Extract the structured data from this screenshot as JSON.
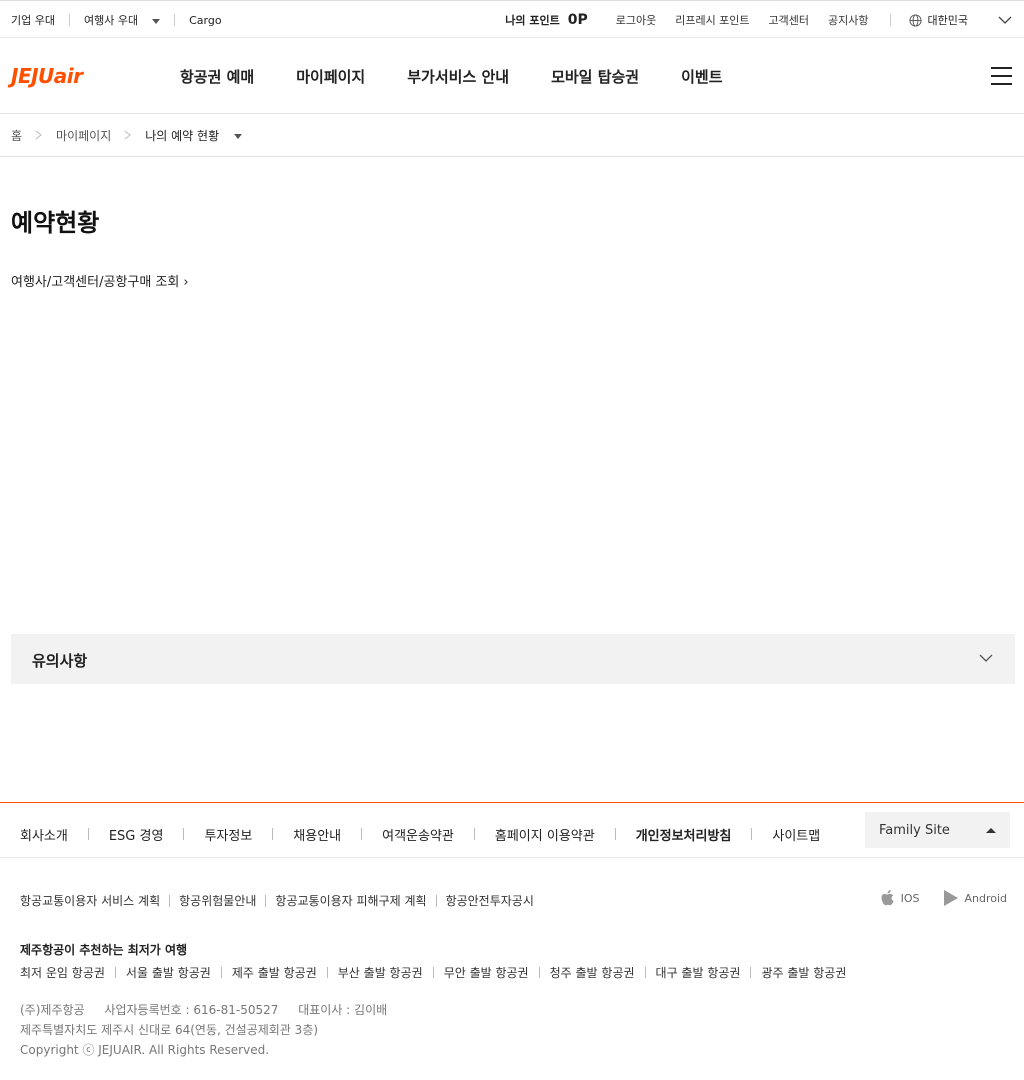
{
  "topbar": {
    "corporate": "기업 우대",
    "agency": "여행사 우대",
    "cargo": "Cargo",
    "my_points_label": "나의 포인트",
    "my_points_value": "0P",
    "logout": "로그아웃",
    "refresh_points": "리프레시 포인트",
    "customer_center": "고객센터",
    "notice": "공지사항",
    "country": "대한민국"
  },
  "logo": {
    "text": "JEJUair"
  },
  "nav": {
    "items": [
      "항공권 예매",
      "마이페이지",
      "부가서비스 안내",
      "모바일 탑승권",
      "이벤트"
    ]
  },
  "breadcrumb": {
    "home": "홈",
    "mypage": "마이페이지",
    "current": "나의 예약 현황"
  },
  "main": {
    "title": "예약현황",
    "lookup_link": "여행사/고객센터/공항구매 조회",
    "lookup_arrow": "›",
    "notice_label": "유의사항"
  },
  "footer": {
    "nav": [
      "회사소개",
      "ESG 경영",
      "투자정보",
      "채용안내",
      "여객운송약관",
      "홈페이지 이용약관",
      "개인정보처리방침",
      "사이트맵"
    ],
    "family_site": "Family Site",
    "service_links": [
      "항공교통이용자 서비스 계획",
      "항공위험물안내",
      "항공교통이용자 피해구제 계획",
      "항공안전투자공시"
    ],
    "apps": {
      "ios": "IOS",
      "android": "Android"
    },
    "recommend_title": "제주항공이 추천하는 최저가 여행",
    "recommend_links": [
      "최저 운임 항공권",
      "서울 출발 항공권",
      "제주 출발 항공권",
      "부산 출발 항공권",
      "무안 출발 항공권",
      "청주 출발 항공권",
      "대구 출발 항공권",
      "광주 출발 항공권"
    ],
    "company_name": "(주)제주항공",
    "business_no": "사업자등록번호 : 616-81-50527",
    "ceo": "대표이사 : 김이배",
    "address": "제주특별자치도 제주시 신대로 64(연동, 건설공제회관 3층)",
    "copyright": "Copyright ⓒ JEJUAIR. All Rights Reserved."
  },
  "colors": {
    "brand": "#ff5000",
    "panel": "#f2f2f2"
  }
}
